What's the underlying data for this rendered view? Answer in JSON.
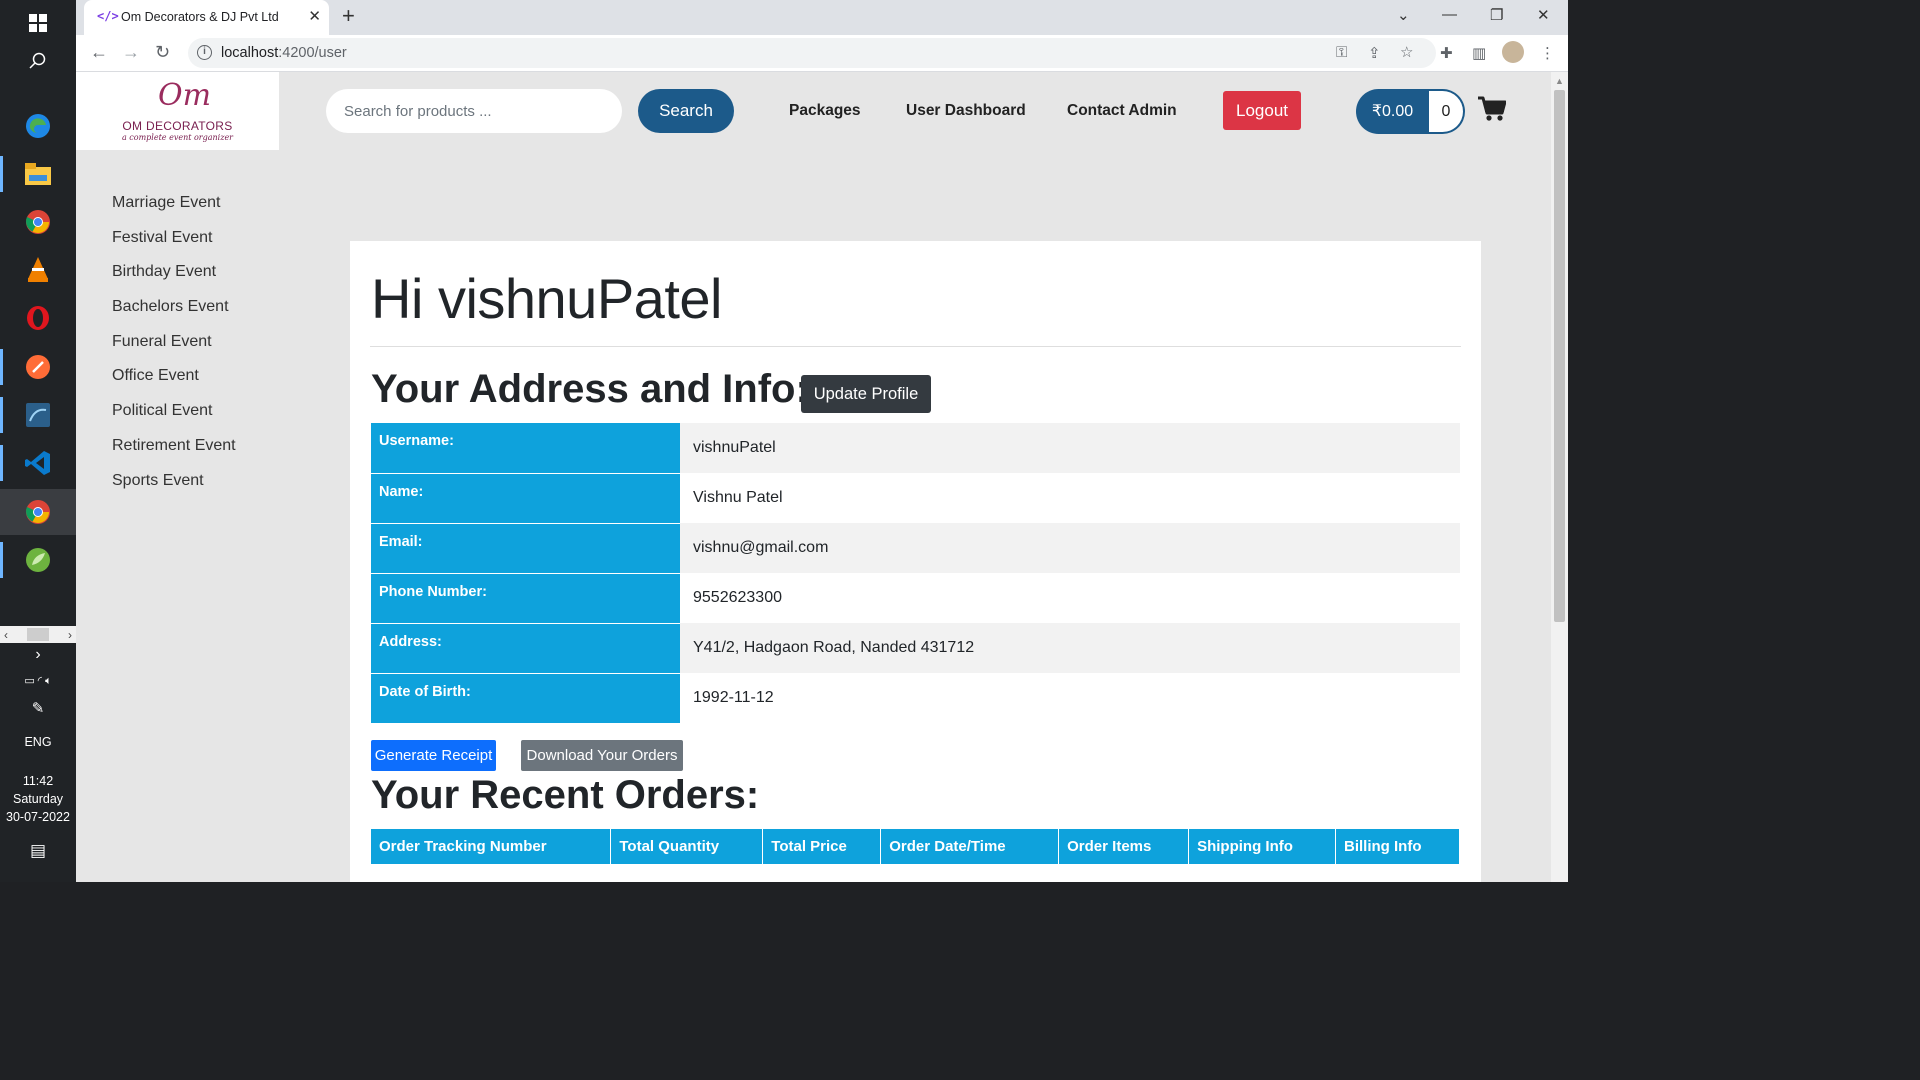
{
  "taskbar": {
    "language": "ENG",
    "time": "11:42",
    "day": "Saturday",
    "date": "30-07-2022"
  },
  "browser": {
    "tab_title": "Om Decorators & DJ Pvt Ltd",
    "url_host": "localhost",
    "url_path": ":4200/user"
  },
  "site": {
    "logo": {
      "mark": "Om",
      "name": "OM DECORATORS",
      "tagline": "a complete event organizer"
    },
    "search": {
      "placeholder": "Search for products ...",
      "button": "Search"
    },
    "nav": {
      "packages": "Packages",
      "user_dashboard": "User Dashboard",
      "contact_admin": "Contact Admin",
      "logout": "Logout"
    },
    "cart": {
      "total": "₹0.00",
      "count": "0"
    }
  },
  "sidebar": {
    "items": [
      "Marriage Event",
      "Festival Event",
      "Birthday Event",
      "Bachelors Event",
      "Funeral Event",
      "Office Event",
      "Political Event",
      "Retirement Event",
      "Sports Event"
    ]
  },
  "main": {
    "greeting": "Hi vishnuPatel",
    "address_title": "Your Address and Info:",
    "update_profile": "Update Profile",
    "info": [
      {
        "label": "Username:",
        "value": "vishnuPatel"
      },
      {
        "label": "Name:",
        "value": "Vishnu Patel"
      },
      {
        "label": "Email:",
        "value": "vishnu@gmail.com"
      },
      {
        "label": "Phone Number:",
        "value": "9552623300"
      },
      {
        "label": "Address:",
        "value": "Y41/2, Hadgaon Road, Nanded 431712"
      },
      {
        "label": "Date of Birth:",
        "value": "1992-11-12"
      }
    ],
    "generate_receipt": "Generate Receipt",
    "download_orders": "Download Your Orders",
    "orders_title": "Your Recent Orders:",
    "orders_columns": [
      "Order Tracking Number",
      "Total Quantity",
      "Total Price",
      "Order Date/Time",
      "Order Items",
      "Shipping Info",
      "Billing Info"
    ]
  },
  "colors": {
    "primary_navy": "#1c5a8a",
    "table_header_cyan": "#0ea2dc",
    "logout_red": "#dc3545",
    "receipt_blue": "#0d6efd",
    "download_gray": "#6c757d",
    "update_dark": "#343a40"
  }
}
